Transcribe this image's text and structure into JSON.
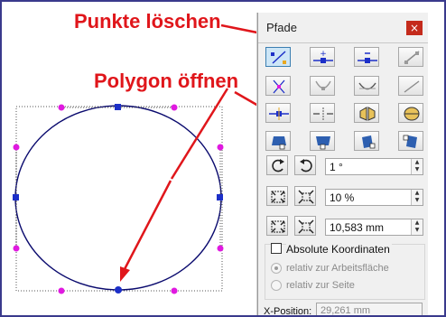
{
  "annotations": {
    "delete_points": "Punkte löschen",
    "open_polygon": "Polygon öffnen"
  },
  "panel": {
    "title": "Pfade",
    "close_glyph": "×",
    "toolbar_rows": [
      [
        "select-nodes-icon",
        "add-node-icon",
        "delete-node-icon",
        "break-node-icon"
      ],
      [
        "node-cusp-icon",
        "node-smooth-icon",
        "node-symmetric-icon",
        "node-line-icon"
      ],
      [
        "open-polygon-icon",
        "close-path-icon",
        "mirror-icon",
        "flip-icon"
      ],
      [
        "shape-icon-1",
        "shape-icon-2",
        "shape-icon-3",
        "shape-icon-4"
      ]
    ],
    "rotation": {
      "value": "1 °"
    },
    "scale": {
      "value": "10 %"
    },
    "distance": {
      "value": "10,583 mm"
    },
    "absolute_coords": {
      "label": "Absolute Koordinaten",
      "checked": false
    },
    "radio_options": [
      "relativ zur Arbeitsfläche",
      "relativ zur Seite"
    ],
    "x_position": {
      "label": "X-Position:",
      "value": "29,261 mm"
    }
  },
  "colors": {
    "annotation": "#e0161b",
    "ellipse_stroke": "#0a0a6e",
    "node": "#1c2fc8",
    "handle": "#e019e0",
    "panel_bg": "#f0f0f0",
    "close_button": "#c42b1c"
  }
}
